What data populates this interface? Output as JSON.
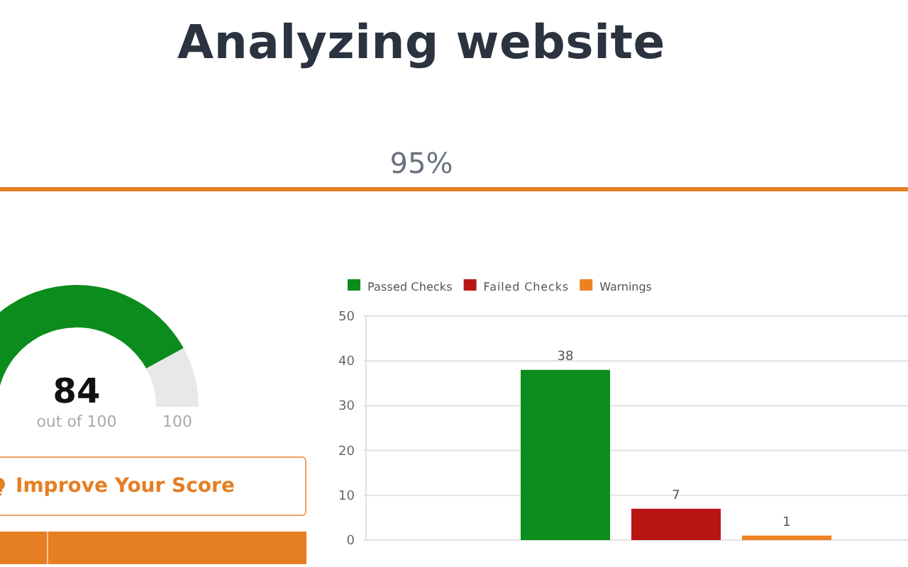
{
  "header": {
    "title": "Analyzing website",
    "progress_text": "95%"
  },
  "score": {
    "value": "84",
    "caption": "out of 100",
    "max_label": "100"
  },
  "improve_button": {
    "label": "Improve Your Score"
  },
  "chart_data": {
    "type": "bar",
    "data_labels": true,
    "grid": true,
    "legend": true,
    "ylim": [
      0,
      50
    ],
    "yticks": [
      0,
      10,
      20,
      30,
      40,
      50
    ],
    "series": [
      {
        "name": "Passed Checks",
        "color": "#0c8c1c",
        "values": [
          38
        ]
      },
      {
        "name": "Failed Checks",
        "color": "#b81414",
        "values": [
          7
        ]
      },
      {
        "name": "Warnings",
        "color": "#ee8122",
        "values": [
          1
        ]
      }
    ]
  }
}
